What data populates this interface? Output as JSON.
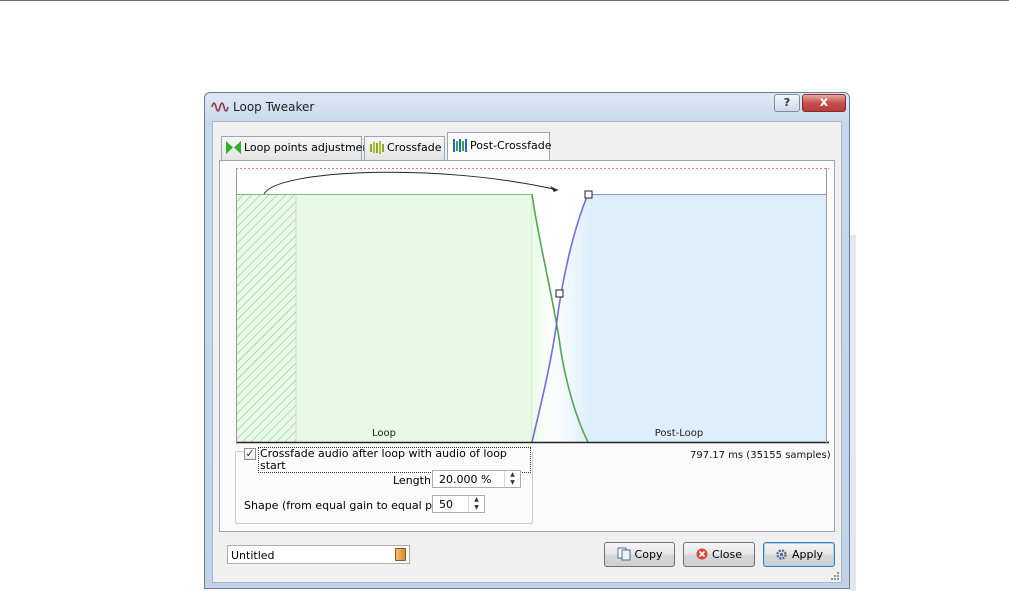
{
  "window": {
    "title": "Loop Tweaker",
    "help_label": "?",
    "close_label": "x"
  },
  "tabs": [
    {
      "label": "Loop points adjustment",
      "active": false,
      "icon": "loop-points-icon"
    },
    {
      "label": "Crossfade",
      "active": false,
      "icon": "crossfade-icon"
    },
    {
      "label": "Post-Crossfade",
      "active": true,
      "icon": "post-crossfade-icon"
    }
  ],
  "plot": {
    "loop_label": "Loop",
    "post_loop_label": "Post-Loop",
    "colors": {
      "loop_fill": "#e7fbe4",
      "post_loop_fill": "#ddeefc",
      "fade_out": "#4caa4c",
      "fade_in": "#6a6ee0"
    }
  },
  "crossfade": {
    "enabled": true,
    "checkbox_label": "Crossfade audio after loop with audio of loop start",
    "length_label": "Length",
    "length_value": "20.000 %",
    "shape_label": "Shape (from equal gain to equal power)",
    "shape_value": "50"
  },
  "duration_text": "797.17 ms (35155 samples)",
  "preset": {
    "value": "Untitled"
  },
  "buttons": {
    "copy": "Copy",
    "close": "Close",
    "apply": "Apply"
  }
}
